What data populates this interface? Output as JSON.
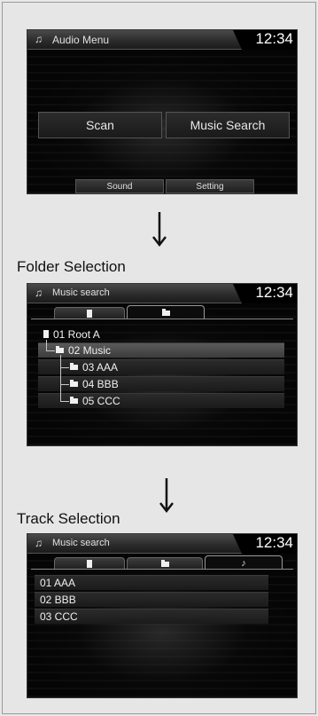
{
  "screen1": {
    "title": "Audio Menu",
    "clock": "12:34",
    "buttons": {
      "scan": "Scan",
      "music_search": "Music Search"
    },
    "soft_buttons": {
      "sound": "Sound",
      "setting": "Setting"
    }
  },
  "caption_folder": "Folder Selection",
  "screen2": {
    "title": "Music search",
    "clock": "12:34",
    "items": [
      {
        "label": "01 Root A",
        "icon": "usb-icon",
        "selected": false
      },
      {
        "label": "02 Music",
        "icon": "folder-icon",
        "selected": true
      },
      {
        "label": "03 AAA",
        "icon": "folder-icon",
        "selected": false
      },
      {
        "label": "04 BBB",
        "icon": "folder-icon",
        "selected": false
      },
      {
        "label": "05 CCC",
        "icon": "folder-icon",
        "selected": false
      }
    ]
  },
  "caption_track": "Track Selection",
  "screen3": {
    "title": "Music search",
    "clock": "12:34",
    "tracks": [
      "01 AAA",
      "02 BBB",
      "03 CCC"
    ]
  },
  "icons": {
    "music": "music-note-icon",
    "usb": "usb-icon",
    "folder": "folder-icon",
    "note_tab": "music-note-icon"
  }
}
